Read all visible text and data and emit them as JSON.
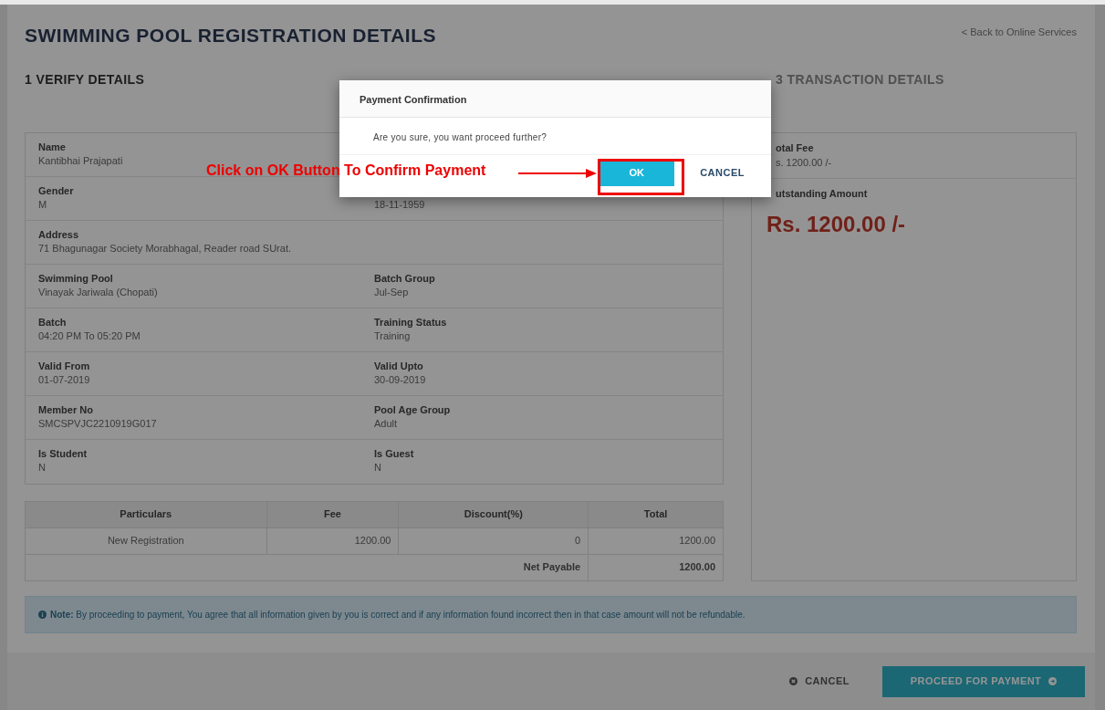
{
  "page": {
    "title": "SWIMMING POOL REGISTRATION DETAILS",
    "back_link": "< Back to Online Services"
  },
  "steps": [
    {
      "label": "1 VERIFY DETAILS",
      "selected": true
    },
    {
      "label": "3 TRANSACTION DETAILS",
      "selected": false
    }
  ],
  "details": [
    {
      "left": {
        "label": "Name",
        "value": "Kantibhai Prajapati"
      }
    },
    {
      "left": {
        "label": "Gender",
        "value": "M"
      },
      "right": {
        "value": "18-11-1959"
      }
    },
    {
      "full": {
        "label": "Address",
        "value": "71 Bhagunagar Society Morabhagal, Reader road SUrat."
      }
    },
    {
      "left": {
        "label": "Swimming Pool",
        "value": "Vinayak Jariwala (Chopati)"
      },
      "right": {
        "label": "Batch Group",
        "value": "Jul-Sep"
      }
    },
    {
      "left": {
        "label": "Batch",
        "value": "04:20 PM To 05:20 PM"
      },
      "right": {
        "label": "Training Status",
        "value": "Training"
      }
    },
    {
      "left": {
        "label": "Valid From",
        "value": "01-07-2019"
      },
      "right": {
        "label": "Valid Upto",
        "value": "30-09-2019"
      }
    },
    {
      "left": {
        "label": "Member No",
        "value": "SMCSPVJC2210919G017"
      },
      "right": {
        "label": "Pool Age Group",
        "value": "Adult"
      }
    },
    {
      "left": {
        "label": "Is Student",
        "value": "N"
      },
      "right": {
        "label": "Is Guest",
        "value": "N"
      }
    }
  ],
  "summary": {
    "total_fee_label": "otal Fee",
    "total_fee_value": "s. 1200.00 /-",
    "outstanding_label": "utstanding Amount",
    "outstanding_value": "Rs. 1200.00 /-"
  },
  "fee_table": {
    "columns": [
      "Particulars",
      "Fee",
      "Discount(%)",
      "Total"
    ],
    "rows": [
      [
        "New Registration",
        "1200.00",
        "0",
        "1200.00"
      ]
    ],
    "net_label": "Net Payable",
    "net_value": "1200.00"
  },
  "note": "**Note:** By proceeding to payment, You agree that all information given by you is correct and if any information found incorrect then in that case amount will not be refundable.",
  "footer": {
    "cancel": "CANCEL",
    "proceed": "PROCEED FOR PAYMENT"
  },
  "modal": {
    "title": "Payment Confirmation",
    "message": "Are you sure, you want proceed further?",
    "ok": "OK",
    "cancel": "CANCEL"
  },
  "annotation": {
    "text": "Click on OK Button To Confirm Payment"
  }
}
